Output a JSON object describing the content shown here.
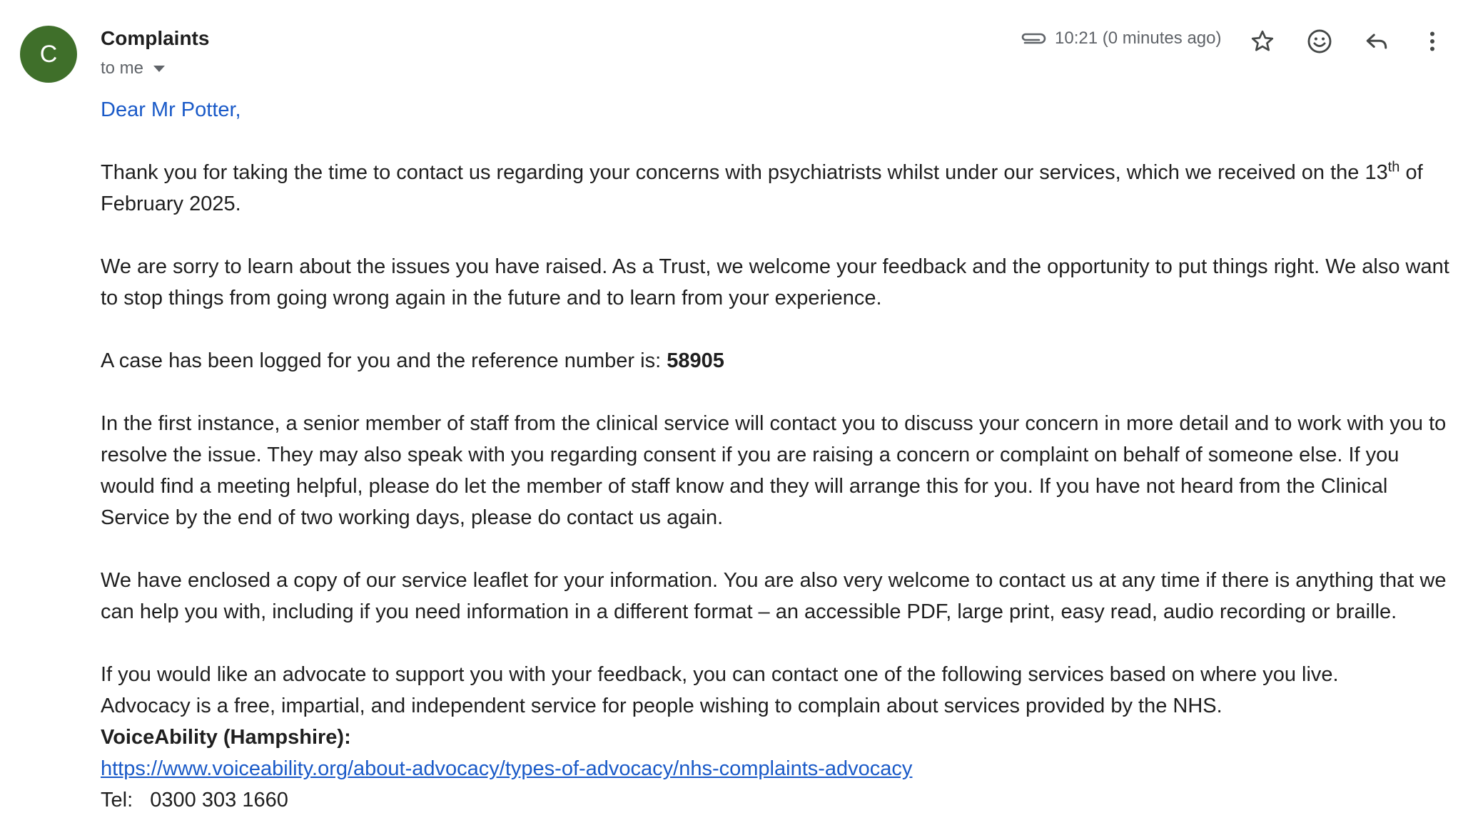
{
  "sender": {
    "avatar_letter": "C",
    "avatar_color": "#3f6f2a",
    "name": "Complaints",
    "recipient": "to me"
  },
  "header": {
    "timestamp": "10:21 (0 minutes ago)",
    "icons": [
      "attachment-icon",
      "star-icon",
      "emoji-icon",
      "reply-icon",
      "more-vert-icon"
    ]
  },
  "email": {
    "greeting": "Dear Mr Potter,",
    "p1_before": "Thank you for taking the time to contact us regarding your concerns with psychiatrists whilst under our services, which we received on the 13",
    "p1_sup": "th",
    "p1_after": " of February 2025.",
    "p2": "We are sorry to learn about the issues you have raised. As a Trust, we welcome your feedback and the opportunity to put things right. We also want to stop things from going wrong again in the future and to learn from your experience.",
    "p3_label": "A case has been logged for you and the reference number is: ",
    "p3_ref": "58905",
    "p4": "In the first instance, a senior member of staff from the clinical service will contact you to discuss your concern in more detail and to work with you to resolve the issue. They may also speak with you regarding consent if you are raising a concern or complaint on behalf of someone else. If you would find a meeting helpful, please do let the member of staff know and they will arrange this for you. If you have not heard from the Clinical Service by the end of two working days, please do contact us again.",
    "p5": "We have enclosed a copy of our service leaflet for your information. You are also very welcome to contact us at any time if there is anything that we can help you with, including if you need information in a different format – an accessible PDF, large print, easy read, audio recording or braille.",
    "p6_line1": "If you would like an advocate to support you with your feedback, you can contact one of the following services based on where you live.",
    "p6_line2": "Advocacy is a free, impartial, and independent service for people wishing to complain about services provided by the NHS.",
    "org_name": "VoiceAbility (Hampshire):",
    "org_link": "https://www.voiceability.org/about-advocacy/types-of-advocacy/nhs-complaints-advocacy",
    "tel": "Tel:   0300 303 1660"
  },
  "colors": {
    "link": "#1a5ac8",
    "text": "#1f1f1f",
    "muted": "#5f6368"
  }
}
